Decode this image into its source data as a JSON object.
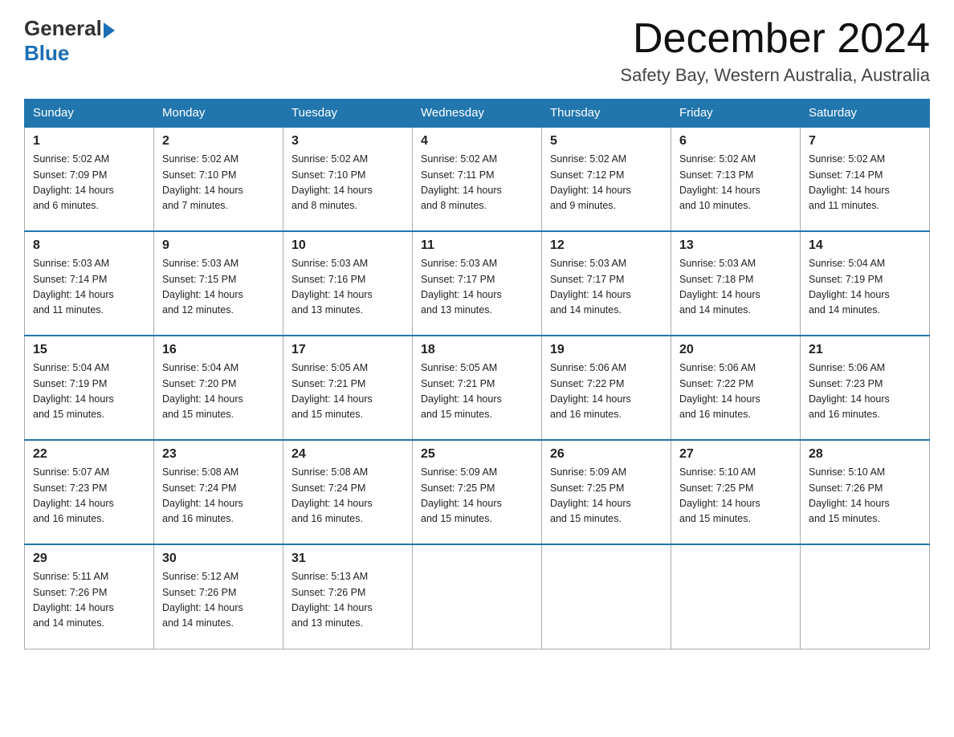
{
  "header": {
    "logo_general": "General",
    "logo_blue": "Blue",
    "title": "December 2024",
    "subtitle": "Safety Bay, Western Australia, Australia"
  },
  "weekdays": [
    "Sunday",
    "Monday",
    "Tuesday",
    "Wednesday",
    "Thursday",
    "Friday",
    "Saturday"
  ],
  "weeks": [
    [
      {
        "day": "1",
        "sunrise": "5:02 AM",
        "sunset": "7:09 PM",
        "daylight": "14 hours and 6 minutes."
      },
      {
        "day": "2",
        "sunrise": "5:02 AM",
        "sunset": "7:10 PM",
        "daylight": "14 hours and 7 minutes."
      },
      {
        "day": "3",
        "sunrise": "5:02 AM",
        "sunset": "7:10 PM",
        "daylight": "14 hours and 8 minutes."
      },
      {
        "day": "4",
        "sunrise": "5:02 AM",
        "sunset": "7:11 PM",
        "daylight": "14 hours and 8 minutes."
      },
      {
        "day": "5",
        "sunrise": "5:02 AM",
        "sunset": "7:12 PM",
        "daylight": "14 hours and 9 minutes."
      },
      {
        "day": "6",
        "sunrise": "5:02 AM",
        "sunset": "7:13 PM",
        "daylight": "14 hours and 10 minutes."
      },
      {
        "day": "7",
        "sunrise": "5:02 AM",
        "sunset": "7:14 PM",
        "daylight": "14 hours and 11 minutes."
      }
    ],
    [
      {
        "day": "8",
        "sunrise": "5:03 AM",
        "sunset": "7:14 PM",
        "daylight": "14 hours and 11 minutes."
      },
      {
        "day": "9",
        "sunrise": "5:03 AM",
        "sunset": "7:15 PM",
        "daylight": "14 hours and 12 minutes."
      },
      {
        "day": "10",
        "sunrise": "5:03 AM",
        "sunset": "7:16 PM",
        "daylight": "14 hours and 13 minutes."
      },
      {
        "day": "11",
        "sunrise": "5:03 AM",
        "sunset": "7:17 PM",
        "daylight": "14 hours and 13 minutes."
      },
      {
        "day": "12",
        "sunrise": "5:03 AM",
        "sunset": "7:17 PM",
        "daylight": "14 hours and 14 minutes."
      },
      {
        "day": "13",
        "sunrise": "5:03 AM",
        "sunset": "7:18 PM",
        "daylight": "14 hours and 14 minutes."
      },
      {
        "day": "14",
        "sunrise": "5:04 AM",
        "sunset": "7:19 PM",
        "daylight": "14 hours and 14 minutes."
      }
    ],
    [
      {
        "day": "15",
        "sunrise": "5:04 AM",
        "sunset": "7:19 PM",
        "daylight": "14 hours and 15 minutes."
      },
      {
        "day": "16",
        "sunrise": "5:04 AM",
        "sunset": "7:20 PM",
        "daylight": "14 hours and 15 minutes."
      },
      {
        "day": "17",
        "sunrise": "5:05 AM",
        "sunset": "7:21 PM",
        "daylight": "14 hours and 15 minutes."
      },
      {
        "day": "18",
        "sunrise": "5:05 AM",
        "sunset": "7:21 PM",
        "daylight": "14 hours and 15 minutes."
      },
      {
        "day": "19",
        "sunrise": "5:06 AM",
        "sunset": "7:22 PM",
        "daylight": "14 hours and 16 minutes."
      },
      {
        "day": "20",
        "sunrise": "5:06 AM",
        "sunset": "7:22 PM",
        "daylight": "14 hours and 16 minutes."
      },
      {
        "day": "21",
        "sunrise": "5:06 AM",
        "sunset": "7:23 PM",
        "daylight": "14 hours and 16 minutes."
      }
    ],
    [
      {
        "day": "22",
        "sunrise": "5:07 AM",
        "sunset": "7:23 PM",
        "daylight": "14 hours and 16 minutes."
      },
      {
        "day": "23",
        "sunrise": "5:08 AM",
        "sunset": "7:24 PM",
        "daylight": "14 hours and 16 minutes."
      },
      {
        "day": "24",
        "sunrise": "5:08 AM",
        "sunset": "7:24 PM",
        "daylight": "14 hours and 16 minutes."
      },
      {
        "day": "25",
        "sunrise": "5:09 AM",
        "sunset": "7:25 PM",
        "daylight": "14 hours and 15 minutes."
      },
      {
        "day": "26",
        "sunrise": "5:09 AM",
        "sunset": "7:25 PM",
        "daylight": "14 hours and 15 minutes."
      },
      {
        "day": "27",
        "sunrise": "5:10 AM",
        "sunset": "7:25 PM",
        "daylight": "14 hours and 15 minutes."
      },
      {
        "day": "28",
        "sunrise": "5:10 AM",
        "sunset": "7:26 PM",
        "daylight": "14 hours and 15 minutes."
      }
    ],
    [
      {
        "day": "29",
        "sunrise": "5:11 AM",
        "sunset": "7:26 PM",
        "daylight": "14 hours and 14 minutes."
      },
      {
        "day": "30",
        "sunrise": "5:12 AM",
        "sunset": "7:26 PM",
        "daylight": "14 hours and 14 minutes."
      },
      {
        "day": "31",
        "sunrise": "5:13 AM",
        "sunset": "7:26 PM",
        "daylight": "14 hours and 13 minutes."
      },
      null,
      null,
      null,
      null
    ]
  ],
  "labels": {
    "sunrise": "Sunrise:",
    "sunset": "Sunset:",
    "daylight": "Daylight:"
  }
}
